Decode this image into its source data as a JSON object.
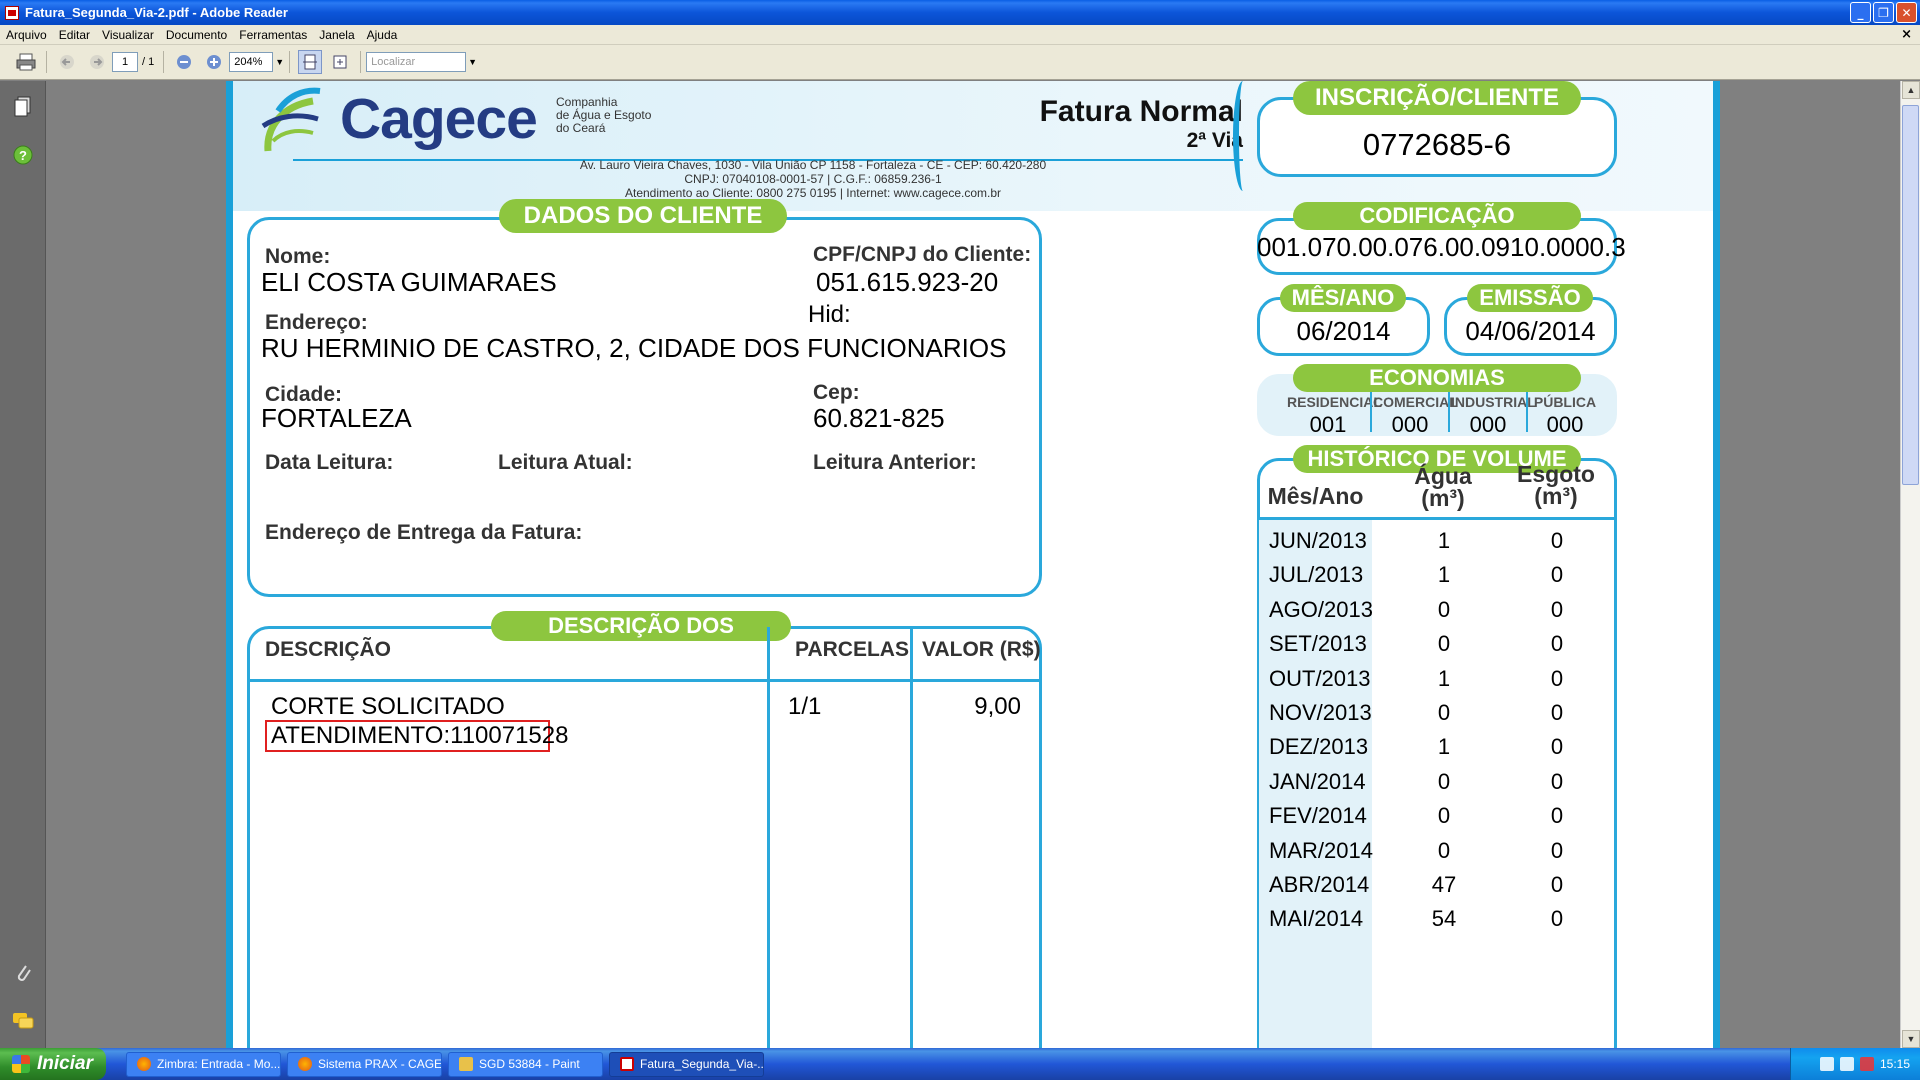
{
  "window": {
    "title": "Fatura_Segunda_Via-2.pdf - Adobe Reader"
  },
  "menu": [
    "Arquivo",
    "Editar",
    "Visualizar",
    "Documento",
    "Ferramentas",
    "Janela",
    "Ajuda"
  ],
  "toolbar": {
    "page_current": "1",
    "page_total": "/ 1",
    "zoom": "204%",
    "find_placeholder": "Localizar"
  },
  "invoice": {
    "company_name": "Cagece",
    "company_sub": [
      "Companhia",
      "de Água e Esgoto",
      "do Ceará"
    ],
    "address_lines": [
      "Av. Lauro Vieira Chaves, 1030 - Vila União CP 1158 - Fortaleza - CE - CEP: 60.420-280",
      "CNPJ: 07040108-0001-57 | C.G.F.: 06859.236-1",
      "Atendimento ao Cliente:  0800 275 0195 | Internet: www.cagece.com.br"
    ],
    "title": "Fatura Normal",
    "via": "2ª Via",
    "inscricao_label": "INSCRIÇÃO/CLIENTE",
    "inscricao_value": "0772685-6",
    "codificacao_label": "CODIFICAÇÃO",
    "codificacao_value": "001.070.00.076.00.0910.0000.3",
    "mes_ano_label": "MÊS/ANO",
    "mes_ano_value": "06/2014",
    "emissao_label": "EMISSÃO",
    "emissao_value": "04/06/2014",
    "economias": {
      "label": "ECONOMIAS",
      "columns": [
        {
          "header": "RESIDENCIAL",
          "value": "001"
        },
        {
          "header": "COMERCIAL",
          "value": "000"
        },
        {
          "header": "INDUSTRIAL",
          "value": "000"
        },
        {
          "header": "PÚBLICA",
          "value": "000"
        }
      ]
    },
    "cliente": {
      "section_label": "DADOS DO CLIENTE",
      "nome_label": "Nome:",
      "nome": "ELI COSTA GUIMARAES",
      "cpf_label": "CPF/CNPJ do Cliente:",
      "cpf": "051.615.923-20",
      "hid_label": "Hid:",
      "endereco_label": "Endereço:",
      "endereco": "RU HERMINIO DE CASTRO, 2, CIDADE DOS FUNCIONARIOS",
      "cidade_label": "Cidade:",
      "cidade": "FORTALEZA",
      "cep_label": "Cep:",
      "cep": "60.821-825",
      "data_leitura_label": "Data Leitura:",
      "leitura_atual_label": "Leitura Atual:",
      "leitura_anterior_label": "Leitura Anterior:",
      "endereco_entrega_label": "Endereço de Entrega da Fatura:"
    },
    "servicos": {
      "section_label": "DESCRIÇÃO DOS SERVIÇOS",
      "col_descricao": "DESCRIÇÃO",
      "col_parcelas": "PARCELAS",
      "col_valor": "VALOR (R$)",
      "item_descricao": "CORTE SOLICITADO",
      "item_parcelas": "1/1",
      "item_valor": "9,00",
      "atendimento": "ATENDIMENTO:110071528"
    },
    "historico": {
      "section_label": "HISTÓRICO DE VOLUME",
      "col_mes": "Mês/Ano",
      "col_agua": [
        "Água",
        "(m³)"
      ],
      "col_esgoto": [
        "Esgoto",
        "(m³)"
      ],
      "rows": [
        {
          "mes": "JUN/2013",
          "agua": "1",
          "esgoto": "0"
        },
        {
          "mes": "JUL/2013",
          "agua": "1",
          "esgoto": "0"
        },
        {
          "mes": "AGO/2013",
          "agua": "0",
          "esgoto": "0"
        },
        {
          "mes": "SET/2013",
          "agua": "0",
          "esgoto": "0"
        },
        {
          "mes": "OUT/2013",
          "agua": "1",
          "esgoto": "0"
        },
        {
          "mes": "NOV/2013",
          "agua": "0",
          "esgoto": "0"
        },
        {
          "mes": "DEZ/2013",
          "agua": "1",
          "esgoto": "0"
        },
        {
          "mes": "JAN/2014",
          "agua": "0",
          "esgoto": "0"
        },
        {
          "mes": "FEV/2014",
          "agua": "0",
          "esgoto": "0"
        },
        {
          "mes": "MAR/2014",
          "agua": "0",
          "esgoto": "0"
        },
        {
          "mes": "ABR/2014",
          "agua": "47",
          "esgoto": "0"
        },
        {
          "mes": "MAI/2014",
          "agua": "54",
          "esgoto": "0"
        }
      ]
    }
  },
  "taskbar": {
    "start_label": "Iniciar",
    "tasks": [
      {
        "label": "Zimbra: Entrada - Mo...",
        "icon": "firefox-icon"
      },
      {
        "label": "Sistema PRAX - CAGE...",
        "icon": "firefox-icon"
      },
      {
        "label": "SGD 53884 - Paint",
        "icon": "paint-icon"
      },
      {
        "label": "Fatura_Segunda_Via-...",
        "icon": "adobe-reader-icon"
      }
    ],
    "clock": "15:15"
  },
  "colors": {
    "accent_blue": "#2aa8db",
    "accent_green": "#8dc63f",
    "brand_navy": "#243c83"
  }
}
